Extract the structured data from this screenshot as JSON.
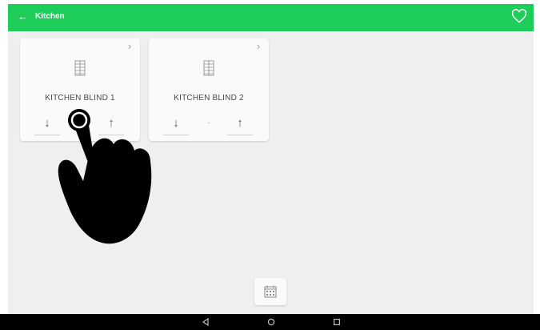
{
  "header": {
    "title": "Kitchen",
    "back_icon": "arrow-left-icon",
    "favorite_icon": "heart-outline-icon",
    "color": "#1ecc5a"
  },
  "devices": [
    {
      "name": "KITCHEN BLIND 1",
      "icon": "blind-icon",
      "down": "↓",
      "up": "↑",
      "stop": ""
    },
    {
      "name": "KITCHEN BLIND 2",
      "icon": "blind-icon",
      "down": "↓",
      "up": "↑",
      "stop": "·"
    }
  ],
  "schedule": {
    "icon": "calendar-icon"
  },
  "navbar": {
    "buttons": [
      "back-triangle-icon",
      "home-circle-icon",
      "recents-square-icon"
    ]
  },
  "overlay": {
    "icon": "pointing-hand-icon"
  },
  "glyphs": {
    "back": "←",
    "chevron": "›"
  }
}
